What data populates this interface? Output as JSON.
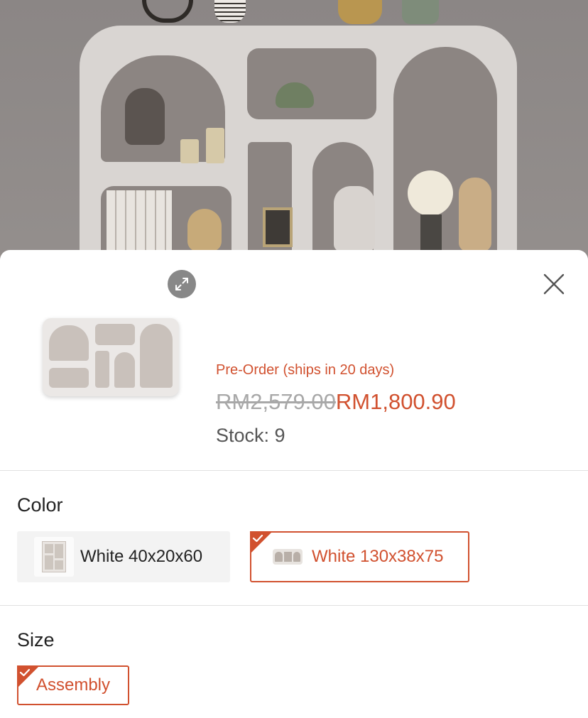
{
  "background": {
    "description_icon": "furniture-photo"
  },
  "sheet": {
    "expand_icon": "expand-arrows-icon",
    "close_icon": "close-icon",
    "preorder_text": "Pre-Order (ships in 20 days)",
    "original_price": "RM2,579.00",
    "sale_price": "RM1,800.90",
    "stock_label": "Stock: ",
    "stock_value": "9"
  },
  "color": {
    "title": "Color",
    "options": [
      {
        "label": "White 40x20x60",
        "selected": false
      },
      {
        "label": "White 130x38x75",
        "selected": true
      }
    ]
  },
  "size": {
    "title": "Size",
    "options": [
      {
        "label": "Assembly",
        "selected": true
      }
    ]
  },
  "colors": {
    "accent": "#d1512f",
    "text": "#222222",
    "muted": "#a8a8a8",
    "option_bg": "#f3f3f3"
  }
}
